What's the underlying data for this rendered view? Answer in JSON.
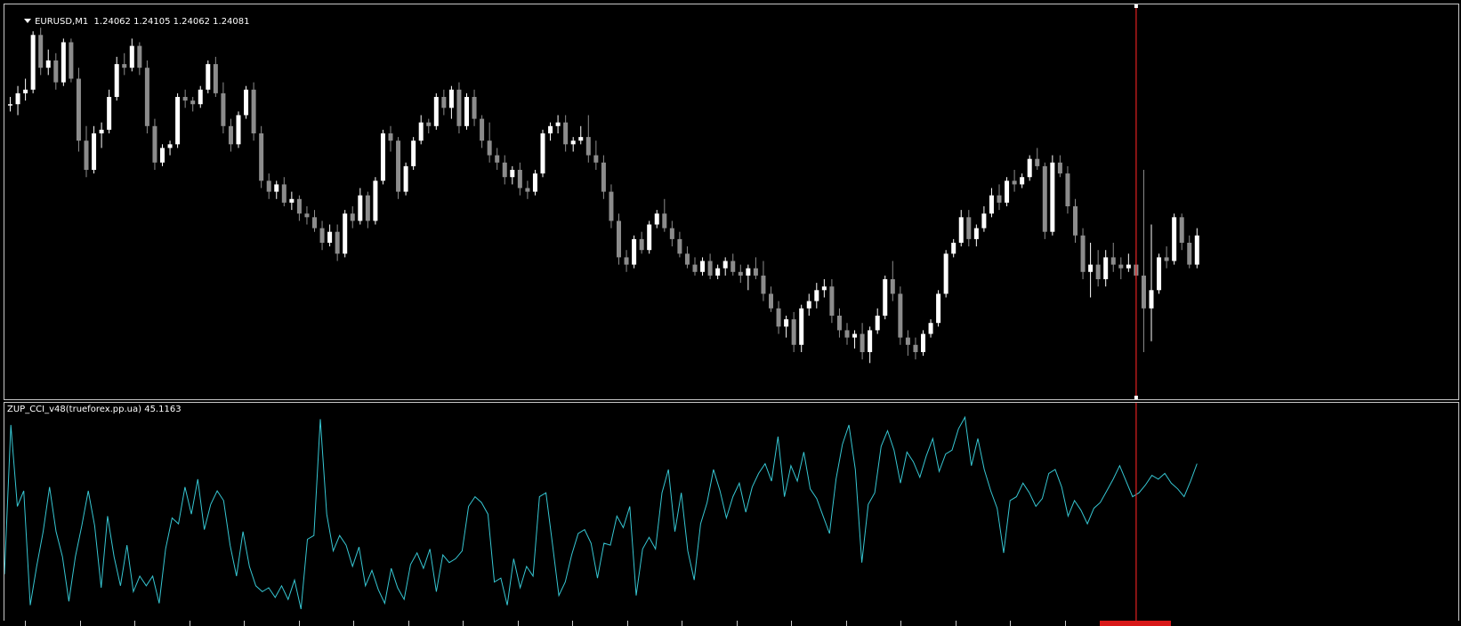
{
  "chart": {
    "symbol_label": "EURUSD,M1  1.24062 1.24105 1.24062 1.24081",
    "indicator_label": "ZUP_CCI_v48(trueforex.pp.ua) 45.1163",
    "colors": {
      "background": "#000000",
      "bull_candle": "#ffffff",
      "bear_candle": "#8c8c8c",
      "indicator_line": "#36c6d2",
      "crosshair": "#e02020",
      "pane_border": "#c8c8c8"
    },
    "price_high_norm": 1.0,
    "candles": [
      [
        0.78,
        0.8,
        0.76,
        0.78
      ],
      [
        0.78,
        0.83,
        0.75,
        0.81
      ],
      [
        0.81,
        0.85,
        0.79,
        0.82
      ],
      [
        0.82,
        0.98,
        0.81,
        0.97
      ],
      [
        0.97,
        0.99,
        0.86,
        0.88
      ],
      [
        0.88,
        0.93,
        0.86,
        0.9
      ],
      [
        0.9,
        0.92,
        0.82,
        0.84
      ],
      [
        0.84,
        0.96,
        0.83,
        0.95
      ],
      [
        0.95,
        0.96,
        0.84,
        0.85
      ],
      [
        0.85,
        0.88,
        0.65,
        0.68
      ],
      [
        0.68,
        0.72,
        0.58,
        0.6
      ],
      [
        0.6,
        0.72,
        0.59,
        0.7
      ],
      [
        0.7,
        0.73,
        0.66,
        0.71
      ],
      [
        0.71,
        0.82,
        0.7,
        0.8
      ],
      [
        0.8,
        0.91,
        0.79,
        0.89
      ],
      [
        0.89,
        0.92,
        0.86,
        0.88
      ],
      [
        0.88,
        0.96,
        0.87,
        0.94
      ],
      [
        0.94,
        0.95,
        0.86,
        0.88
      ],
      [
        0.88,
        0.9,
        0.7,
        0.72
      ],
      [
        0.72,
        0.74,
        0.6,
        0.62
      ],
      [
        0.62,
        0.67,
        0.61,
        0.66
      ],
      [
        0.66,
        0.68,
        0.64,
        0.67
      ],
      [
        0.67,
        0.81,
        0.66,
        0.8
      ],
      [
        0.8,
        0.82,
        0.77,
        0.79
      ],
      [
        0.79,
        0.8,
        0.76,
        0.78
      ],
      [
        0.78,
        0.83,
        0.77,
        0.82
      ],
      [
        0.82,
        0.9,
        0.81,
        0.89
      ],
      [
        0.89,
        0.91,
        0.8,
        0.81
      ],
      [
        0.81,
        0.84,
        0.7,
        0.72
      ],
      [
        0.72,
        0.74,
        0.65,
        0.67
      ],
      [
        0.67,
        0.76,
        0.66,
        0.75
      ],
      [
        0.75,
        0.83,
        0.74,
        0.82
      ],
      [
        0.82,
        0.84,
        0.68,
        0.7
      ],
      [
        0.7,
        0.72,
        0.55,
        0.57
      ],
      [
        0.57,
        0.59,
        0.52,
        0.54
      ],
      [
        0.54,
        0.57,
        0.52,
        0.56
      ],
      [
        0.56,
        0.58,
        0.5,
        0.51
      ],
      [
        0.51,
        0.54,
        0.49,
        0.52
      ],
      [
        0.52,
        0.53,
        0.46,
        0.48
      ],
      [
        0.48,
        0.5,
        0.45,
        0.47
      ],
      [
        0.47,
        0.49,
        0.43,
        0.44
      ],
      [
        0.44,
        0.46,
        0.38,
        0.4
      ],
      [
        0.4,
        0.45,
        0.39,
        0.43
      ],
      [
        0.43,
        0.45,
        0.35,
        0.37
      ],
      [
        0.37,
        0.49,
        0.36,
        0.48
      ],
      [
        0.48,
        0.5,
        0.44,
        0.46
      ],
      [
        0.46,
        0.55,
        0.45,
        0.53
      ],
      [
        0.53,
        0.54,
        0.44,
        0.46
      ],
      [
        0.46,
        0.58,
        0.45,
        0.57
      ],
      [
        0.57,
        0.71,
        0.56,
        0.7
      ],
      [
        0.7,
        0.72,
        0.65,
        0.68
      ],
      [
        0.68,
        0.69,
        0.52,
        0.54
      ],
      [
        0.54,
        0.62,
        0.53,
        0.61
      ],
      [
        0.61,
        0.69,
        0.6,
        0.68
      ],
      [
        0.68,
        0.75,
        0.67,
        0.73
      ],
      [
        0.73,
        0.74,
        0.7,
        0.72
      ],
      [
        0.72,
        0.81,
        0.71,
        0.8
      ],
      [
        0.8,
        0.82,
        0.75,
        0.77
      ],
      [
        0.77,
        0.83,
        0.74,
        0.82
      ],
      [
        0.82,
        0.84,
        0.7,
        0.72
      ],
      [
        0.72,
        0.81,
        0.71,
        0.8
      ],
      [
        0.8,
        0.82,
        0.72,
        0.74
      ],
      [
        0.74,
        0.75,
        0.66,
        0.68
      ],
      [
        0.68,
        0.73,
        0.62,
        0.64
      ],
      [
        0.64,
        0.66,
        0.6,
        0.62
      ],
      [
        0.62,
        0.64,
        0.56,
        0.58
      ],
      [
        0.58,
        0.61,
        0.56,
        0.6
      ],
      [
        0.6,
        0.62,
        0.53,
        0.55
      ],
      [
        0.55,
        0.57,
        0.52,
        0.54
      ],
      [
        0.54,
        0.6,
        0.53,
        0.59
      ],
      [
        0.59,
        0.71,
        0.58,
        0.7
      ],
      [
        0.7,
        0.73,
        0.68,
        0.72
      ],
      [
        0.72,
        0.75,
        0.7,
        0.73
      ],
      [
        0.73,
        0.75,
        0.65,
        0.67
      ],
      [
        0.67,
        0.69,
        0.65,
        0.68
      ],
      [
        0.68,
        0.72,
        0.67,
        0.69
      ],
      [
        0.69,
        0.75,
        0.62,
        0.64
      ],
      [
        0.64,
        0.68,
        0.6,
        0.62
      ],
      [
        0.62,
        0.64,
        0.52,
        0.54
      ],
      [
        0.54,
        0.56,
        0.44,
        0.46
      ],
      [
        0.46,
        0.48,
        0.34,
        0.36
      ],
      [
        0.36,
        0.38,
        0.32,
        0.34
      ],
      [
        0.34,
        0.42,
        0.33,
        0.41
      ],
      [
        0.41,
        0.43,
        0.37,
        0.38
      ],
      [
        0.38,
        0.46,
        0.37,
        0.45
      ],
      [
        0.45,
        0.49,
        0.44,
        0.48
      ],
      [
        0.48,
        0.52,
        0.43,
        0.44
      ],
      [
        0.44,
        0.46,
        0.39,
        0.41
      ],
      [
        0.41,
        0.43,
        0.36,
        0.37
      ],
      [
        0.37,
        0.39,
        0.33,
        0.34
      ],
      [
        0.34,
        0.36,
        0.31,
        0.32
      ],
      [
        0.32,
        0.36,
        0.31,
        0.35
      ],
      [
        0.35,
        0.37,
        0.3,
        0.31
      ],
      [
        0.31,
        0.34,
        0.3,
        0.33
      ],
      [
        0.33,
        0.36,
        0.31,
        0.35
      ],
      [
        0.35,
        0.37,
        0.31,
        0.32
      ],
      [
        0.32,
        0.34,
        0.29,
        0.31
      ],
      [
        0.31,
        0.34,
        0.27,
        0.33
      ],
      [
        0.33,
        0.36,
        0.3,
        0.31
      ],
      [
        0.31,
        0.35,
        0.24,
        0.26
      ],
      [
        0.26,
        0.28,
        0.21,
        0.22
      ],
      [
        0.22,
        0.24,
        0.15,
        0.17
      ],
      [
        0.17,
        0.2,
        0.14,
        0.19
      ],
      [
        0.19,
        0.21,
        0.1,
        0.12
      ],
      [
        0.12,
        0.23,
        0.1,
        0.22
      ],
      [
        0.22,
        0.26,
        0.2,
        0.24
      ],
      [
        0.24,
        0.29,
        0.22,
        0.27
      ],
      [
        0.27,
        0.3,
        0.25,
        0.28
      ],
      [
        0.28,
        0.3,
        0.18,
        0.2
      ],
      [
        0.2,
        0.22,
        0.14,
        0.16
      ],
      [
        0.16,
        0.18,
        0.12,
        0.14
      ],
      [
        0.14,
        0.16,
        0.11,
        0.15
      ],
      [
        0.15,
        0.18,
        0.08,
        0.1
      ],
      [
        0.1,
        0.17,
        0.07,
        0.16
      ],
      [
        0.16,
        0.22,
        0.15,
        0.2
      ],
      [
        0.2,
        0.31,
        0.19,
        0.3
      ],
      [
        0.3,
        0.35,
        0.24,
        0.26
      ],
      [
        0.26,
        0.28,
        0.12,
        0.14
      ],
      [
        0.14,
        0.16,
        0.09,
        0.12
      ],
      [
        0.12,
        0.14,
        0.08,
        0.1
      ],
      [
        0.1,
        0.16,
        0.09,
        0.15
      ],
      [
        0.15,
        0.19,
        0.14,
        0.18
      ],
      [
        0.18,
        0.27,
        0.17,
        0.26
      ],
      [
        0.26,
        0.38,
        0.25,
        0.37
      ],
      [
        0.37,
        0.41,
        0.36,
        0.4
      ],
      [
        0.4,
        0.49,
        0.39,
        0.47
      ],
      [
        0.47,
        0.49,
        0.39,
        0.41
      ],
      [
        0.41,
        0.45,
        0.39,
        0.44
      ],
      [
        0.44,
        0.5,
        0.43,
        0.48
      ],
      [
        0.48,
        0.55,
        0.47,
        0.53
      ],
      [
        0.53,
        0.56,
        0.49,
        0.51
      ],
      [
        0.51,
        0.58,
        0.5,
        0.57
      ],
      [
        0.57,
        0.6,
        0.54,
        0.56
      ],
      [
        0.56,
        0.59,
        0.55,
        0.58
      ],
      [
        0.58,
        0.64,
        0.57,
        0.63
      ],
      [
        0.63,
        0.66,
        0.6,
        0.61
      ],
      [
        0.61,
        0.62,
        0.41,
        0.43
      ],
      [
        0.43,
        0.64,
        0.42,
        0.62
      ],
      [
        0.62,
        0.64,
        0.58,
        0.59
      ],
      [
        0.59,
        0.61,
        0.48,
        0.5
      ],
      [
        0.5,
        0.52,
        0.4,
        0.42
      ],
      [
        0.42,
        0.44,
        0.3,
        0.32
      ],
      [
        0.32,
        0.4,
        0.25,
        0.34
      ],
      [
        0.34,
        0.38,
        0.28,
        0.3
      ],
      [
        0.3,
        0.38,
        0.28,
        0.36
      ],
      [
        0.36,
        0.4,
        0.32,
        0.34
      ],
      [
        0.34,
        0.36,
        0.3,
        0.33
      ],
      [
        0.33,
        0.37,
        0.32,
        0.34
      ],
      [
        0.34,
        0.38,
        0.3,
        0.31
      ],
      [
        0.31,
        0.6,
        0.1,
        0.22
      ],
      [
        0.22,
        0.45,
        0.13,
        0.27
      ],
      [
        0.27,
        0.37,
        0.26,
        0.36
      ],
      [
        0.36,
        0.39,
        0.33,
        0.35
      ],
      [
        0.35,
        0.48,
        0.34,
        0.47
      ],
      [
        0.47,
        0.48,
        0.38,
        0.4
      ],
      [
        0.4,
        0.42,
        0.33,
        0.34
      ],
      [
        0.34,
        0.44,
        0.33,
        0.42
      ]
    ],
    "cci": [
      18,
      95,
      53,
      61,
      2,
      22,
      40,
      63,
      40,
      27,
      4,
      27,
      43,
      61,
      43,
      11,
      48,
      27,
      12,
      33,
      9,
      17,
      12,
      17,
      3,
      31,
      47,
      44,
      63,
      49,
      67,
      41,
      54,
      61,
      56,
      33,
      17,
      40,
      22,
      12,
      9,
      11,
      6,
      12,
      5,
      15,
      0,
      36,
      38,
      98,
      49,
      30,
      38,
      33,
      22,
      32,
      12,
      20,
      10,
      3,
      21,
      11,
      5,
      23,
      29,
      21,
      31,
      9,
      28,
      24,
      26,
      30,
      53,
      58,
      55,
      49,
      14,
      16,
      2,
      26,
      11,
      22,
      17,
      58,
      60,
      34,
      7,
      14,
      28,
      39,
      41,
      34,
      16,
      34,
      33,
      48,
      42,
      53,
      7,
      31,
      37,
      31,
      60,
      72,
      40,
      60,
      30,
      15,
      44,
      55,
      72,
      61,
      47,
      58,
      65,
      50,
      63,
      70,
      75,
      66,
      89,
      58,
      74,
      66,
      81,
      62,
      57,
      48,
      39,
      67,
      85,
      95,
      72,
      24,
      54,
      60,
      84,
      92,
      82,
      65,
      81,
      76,
      68,
      79,
      88,
      71,
      80,
      82,
      93,
      99,
      74,
      88,
      72,
      61,
      52,
      29,
      56,
      58,
      65,
      60,
      53,
      57,
      70,
      72,
      63,
      48,
      56,
      51,
      44,
      52,
      55,
      61,
      67,
      74,
      66,
      58,
      60,
      64,
      69,
      67,
      70,
      65,
      62,
      58,
      66,
      75
    ],
    "crosshair_candle_index": 148
  }
}
